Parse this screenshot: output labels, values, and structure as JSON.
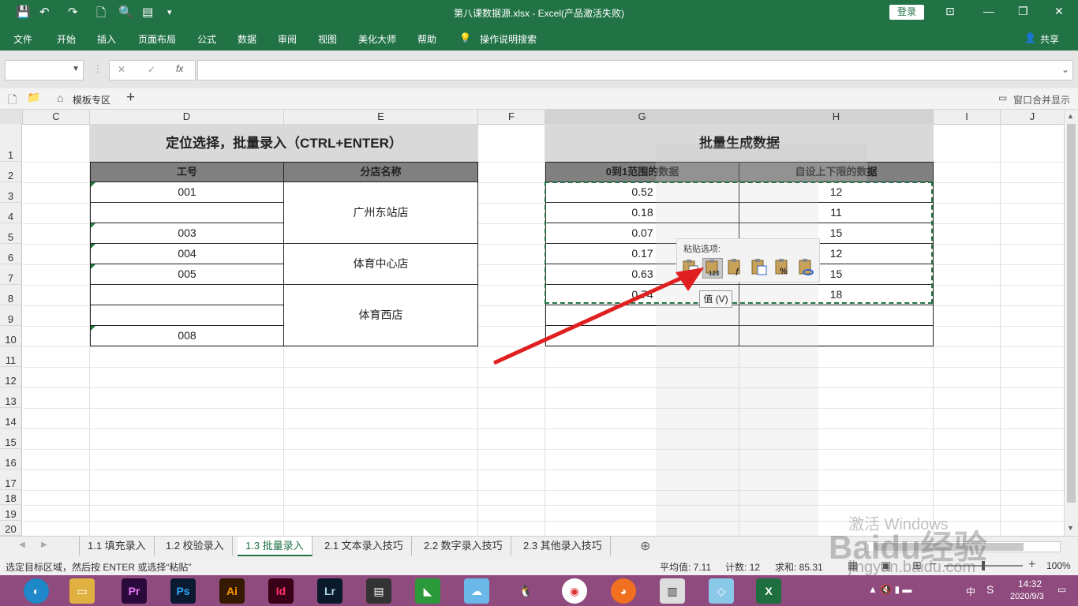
{
  "window": {
    "title": "第八课数据源.xlsx  -  Excel(产品激活失败)",
    "login": "登录"
  },
  "ribbon": {
    "tabs": [
      "文件",
      "开始",
      "插入",
      "页面布局",
      "公式",
      "数据",
      "审阅",
      "视图",
      "美化大师",
      "帮助"
    ],
    "tell_me": "操作说明搜索",
    "share": "共享"
  },
  "formula_bar": {
    "fx": "fx"
  },
  "doc_tabs": {
    "template_zone": "模板专区",
    "window_merge": "窗口合并显示"
  },
  "columns": [
    "C",
    "D",
    "E",
    "F",
    "G",
    "H",
    "I",
    "J"
  ],
  "rows": [
    "1",
    "2",
    "3",
    "4",
    "5",
    "6",
    "7",
    "8",
    "9",
    "10",
    "11",
    "12",
    "13",
    "14",
    "15",
    "16",
    "17",
    "18",
    "19",
    "20"
  ],
  "left_table": {
    "title": "定位选择，批量录入（CTRL+ENTER）",
    "headers": [
      "工号",
      "分店名称"
    ],
    "ids": [
      "001",
      "",
      "003",
      "004",
      "005",
      "",
      "",
      "008"
    ],
    "stores": [
      "广州东站店",
      "体育中心店",
      "体育西店"
    ]
  },
  "right_table": {
    "title": "批量生成数据",
    "headers": [
      "0到1范围的数据",
      "自设上下限的数据"
    ],
    "col_g": [
      "0.52",
      "0.18",
      "0.07",
      "0.17",
      "0.63",
      "0.74"
    ],
    "col_h": [
      "12",
      "11",
      "15",
      "12",
      "15",
      "18"
    ]
  },
  "paste_popup": {
    "label": "粘贴选项:",
    "icon_text_values": "123",
    "tooltip": "值 (V)"
  },
  "sheet_tabs": [
    "1.1 填充录入",
    "1.2 校验录入",
    "1.3 批量录入",
    "2.1 文本录入技巧",
    "2.2 数字录入技巧",
    "2.3 其他录入技巧"
  ],
  "active_sheet": "1.3 批量录入",
  "status": {
    "message": "选定目标区域，然后按 ENTER 或选择“粘贴”",
    "average": "平均值: 7.11",
    "count": "计数: 12",
    "sum": "求和: 85.31",
    "zoom": "100%"
  },
  "watermark": {
    "activate": "激活 Windows",
    "brand": "Baidu经验",
    "url": "jingyan.baidu.com"
  },
  "taskbar": {
    "apps": [
      "Pr",
      "Ps",
      "Ai",
      "Id",
      "Lr"
    ],
    "time": "14:32",
    "date": "2020/9/3",
    "ime": "中"
  },
  "colors": {
    "excel_green": "#217346",
    "taskbar": "#8f4a7e",
    "arrow": "#e02020"
  }
}
